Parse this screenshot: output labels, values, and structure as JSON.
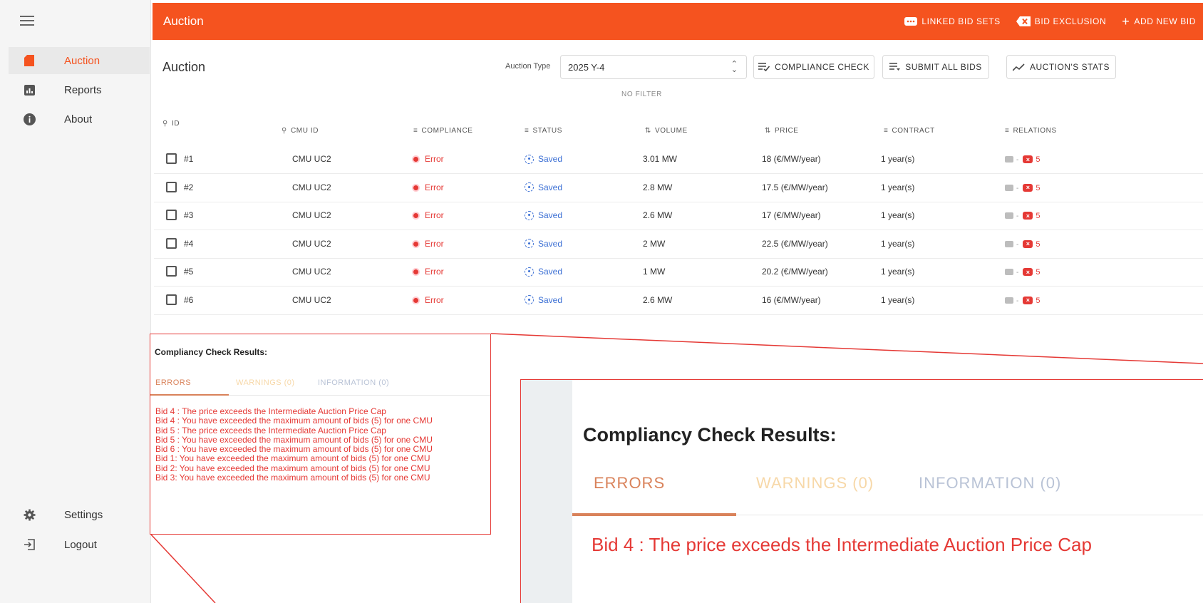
{
  "sidebar": {
    "items": [
      {
        "label": "Auction",
        "icon": "sd-card-icon",
        "active": true
      },
      {
        "label": "Reports",
        "icon": "bar-chart-icon"
      },
      {
        "label": "About",
        "icon": "info-icon"
      }
    ],
    "bottom": [
      {
        "label": "Settings",
        "icon": "gear-icon"
      },
      {
        "label": "Logout",
        "icon": "logout-icon"
      }
    ]
  },
  "topbar": {
    "title": "Auction",
    "actions": [
      {
        "label": "LINKED BID SETS",
        "icon": "linked-tag-icon"
      },
      {
        "label": "BID EXCLUSION",
        "icon": "exclusion-x-icon"
      },
      {
        "label": "ADD NEW BID",
        "icon": "plus-icon"
      }
    ]
  },
  "toolbar": {
    "title": "Auction",
    "auction_type_label": "Auction Type",
    "auction_type_value": "2025 Y-4",
    "compliance_check": "COMPLIANCE CHECK",
    "submit_all": "SUBMIT ALL BIDS",
    "stats": "AUCTION'S STATS",
    "no_filter": "NO FILTER"
  },
  "table": {
    "headers": {
      "id": "ID",
      "cmu_id": "CMU ID",
      "compliance": "COMPLIANCE",
      "status": "STATUS",
      "volume": "VOLUME",
      "price": "PRICE",
      "contract": "CONTRACT",
      "relations": "RELATIONS"
    },
    "rows": [
      {
        "id": "#1",
        "cmu": "CMU UC2",
        "compliance": "Error",
        "status": "Saved",
        "volume": "3.01 MW",
        "price": "18 (€/MW/year)",
        "contract": "1 year(s)",
        "rel_sep": "-",
        "rel_count": "5"
      },
      {
        "id": "#2",
        "cmu": "CMU UC2",
        "compliance": "Error",
        "status": "Saved",
        "volume": "2.8 MW",
        "price": "17.5 (€/MW/year)",
        "contract": "1 year(s)",
        "rel_sep": "-",
        "rel_count": "5"
      },
      {
        "id": "#3",
        "cmu": "CMU UC2",
        "compliance": "Error",
        "status": "Saved",
        "volume": "2.6 MW",
        "price": "17 (€/MW/year)",
        "contract": "1 year(s)",
        "rel_sep": "-",
        "rel_count": "5"
      },
      {
        "id": "#4",
        "cmu": "CMU UC2",
        "compliance": "Error",
        "status": "Saved",
        "volume": "2 MW",
        "price": "22.5 (€/MW/year)",
        "contract": "1 year(s)",
        "rel_sep": "-",
        "rel_count": "5"
      },
      {
        "id": "#5",
        "cmu": "CMU UC2",
        "compliance": "Error",
        "status": "Saved",
        "volume": "1 MW",
        "price": "20.2 (€/MW/year)",
        "contract": "1 year(s)",
        "rel_sep": "-",
        "rel_count": "5"
      },
      {
        "id": "#6",
        "cmu": "CMU UC2",
        "compliance": "Error",
        "status": "Saved",
        "volume": "2.6 MW",
        "price": "16 (€/MW/year)",
        "contract": "1 year(s)",
        "rel_sep": "-",
        "rel_count": "5"
      }
    ]
  },
  "compliance": {
    "title": "Compliancy Check Results:",
    "tabs": [
      {
        "label": "ERRORS",
        "color": "#d9825a"
      },
      {
        "label": "WARNINGS (0)",
        "color": "#f7d8a8"
      },
      {
        "label": "INFORMATION (0)",
        "color": "#b9c3d6"
      }
    ],
    "errors": [
      "Bid 4  : The price exceeds the Intermediate Auction Price Cap",
      "Bid 4  : You have exceeded the maximum amount of bids (5) for one CMU",
      "Bid 5  : The price exceeds the Intermediate  Auction Price Cap",
      "Bid 5  : You have exceeded the maximum amount of bids (5) for one CMU",
      "Bid 6  : You have exceeded the maximum amount of bids (5) for one CMU",
      "Bid 1: You have exceeded the maximum amount of bids (5) for one CMU",
      "Bid 2: You have exceeded the maximum amount of bids (5) for one CMU",
      "Bid 3: You have exceeded the maximum amount of bids (5) for one CMU"
    ]
  },
  "zoom": {
    "title": "Compliancy Check Results:",
    "tabs": [
      "ERRORS",
      "WARNINGS (0)",
      "INFORMATION (0)"
    ],
    "first_line": "Bid 4  : The price exceeds the Intermediate Auction Price Cap"
  },
  "colors": {
    "accent": "#f5531f",
    "error": "#e53935",
    "saved": "#3b6fd4",
    "callout": "#e53935"
  }
}
